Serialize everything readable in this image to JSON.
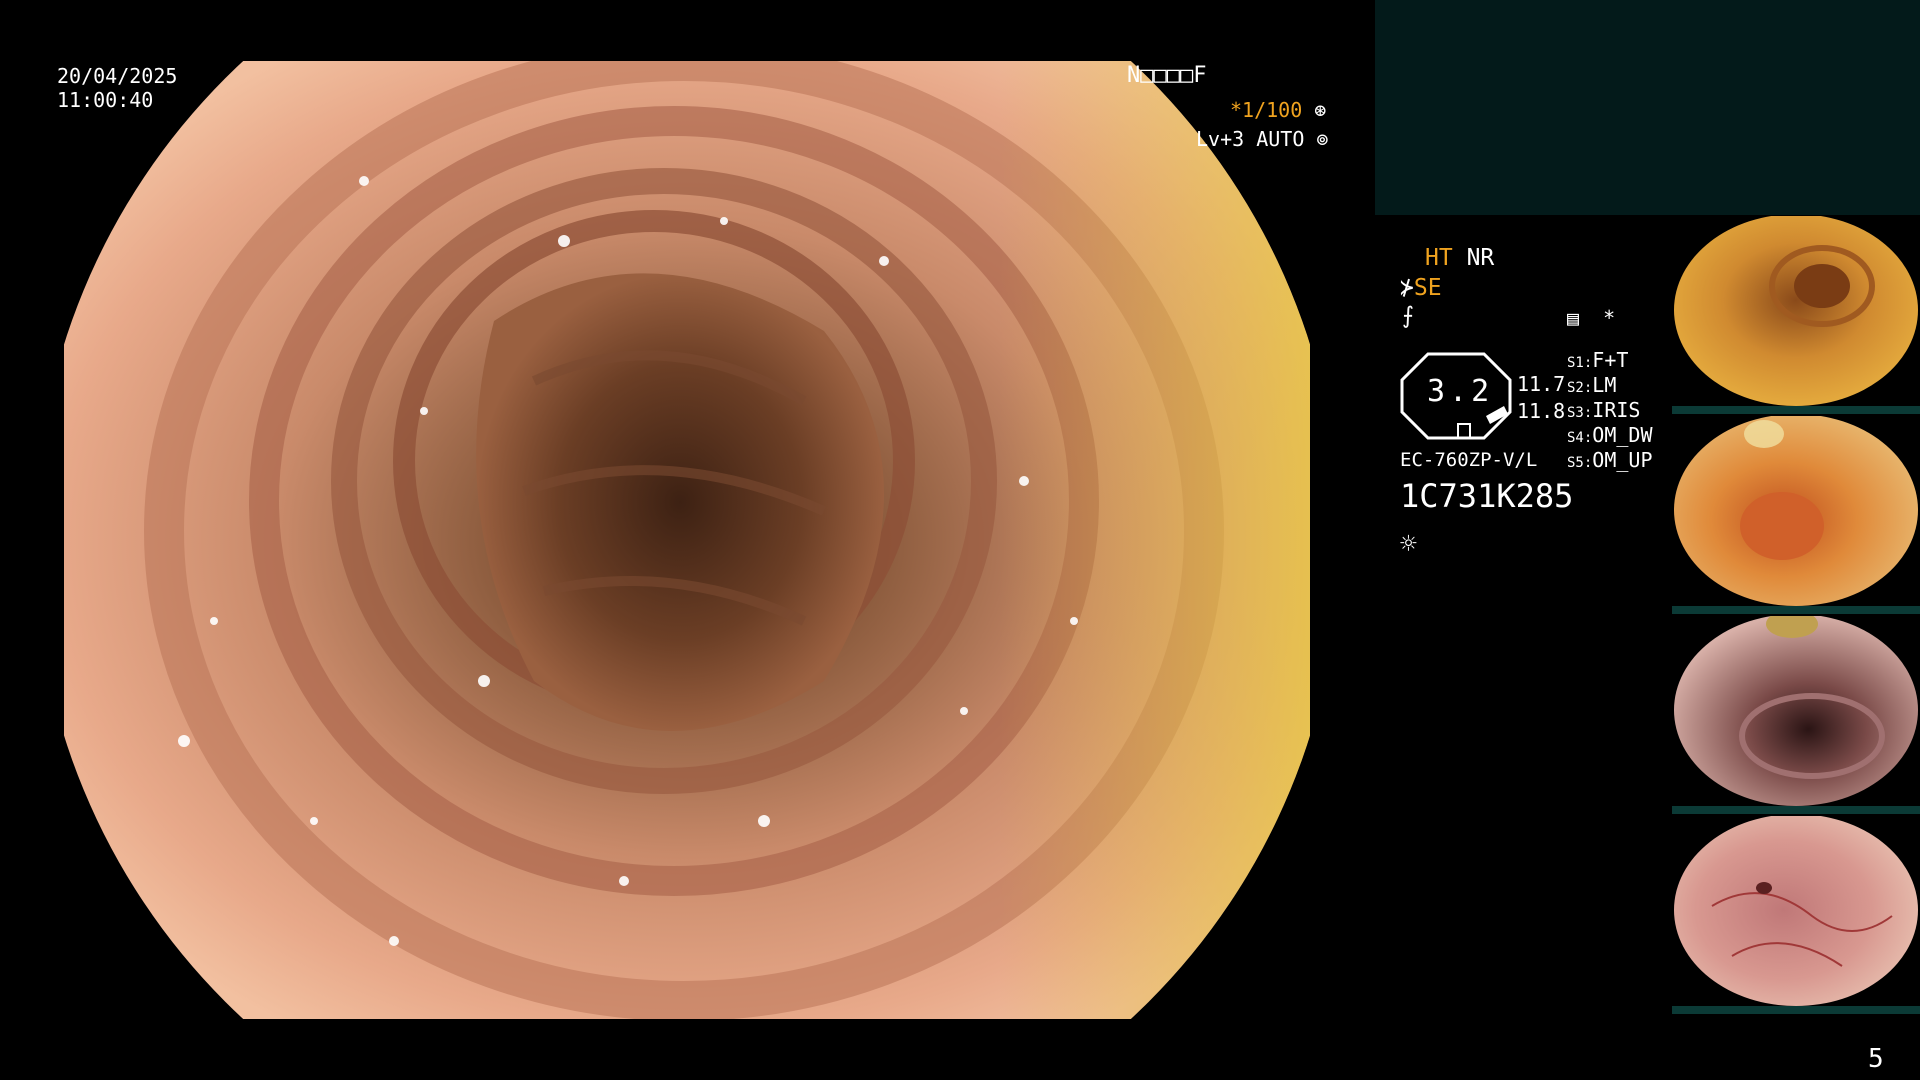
{
  "overlay": {
    "date": "20/04/2025",
    "time": "11:00:40",
    "patient_code": "N□□□□F",
    "shutter": "*1/100",
    "shutter_icon": "aperture-icon",
    "level": "Lv+3 AUTO",
    "level_icon": "auto-iris-icon",
    "mode_ht": "HT",
    "mode_nr": "NR",
    "mode_se": "SE",
    "slot_icon": "memory-card-icon",
    "slot_star": "*",
    "zoom": "3.2",
    "val1": "11.7",
    "val2": "11.8",
    "scope_model": "EC-760ZP-V/L",
    "scope_serial": "1C731K285",
    "light_icon": "sun-icon",
    "switches": [
      {
        "key": "S1",
        "value": "F+T"
      },
      {
        "key": "S2",
        "value": "LM"
      },
      {
        "key": "S3",
        "value": "IRIS"
      },
      {
        "key": "S4",
        "value": "OM_DW"
      },
      {
        "key": "S5",
        "value": "OM_UP"
      }
    ],
    "page_number": "5"
  },
  "colors": {
    "orange": "#f0a31f",
    "panel_teal": "#031a1a",
    "thumb_bar": "#0b3a36"
  },
  "thumbnails": [
    {
      "name": "thumbnail-1",
      "tone": "yellow-orange mucosa"
    },
    {
      "name": "thumbnail-2",
      "tone": "orange mucosa with bubble"
    },
    {
      "name": "thumbnail-3",
      "tone": "pink folds with dark lumen"
    },
    {
      "name": "thumbnail-4",
      "tone": "pink mucosa with vessels"
    }
  ]
}
